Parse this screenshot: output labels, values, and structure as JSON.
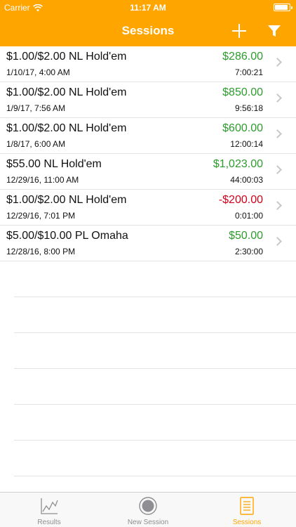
{
  "status_bar": {
    "carrier": "Carrier",
    "time": "11:17 AM",
    "battery_level": 0.9
  },
  "nav": {
    "title": "Sessions",
    "add_icon": "plus-icon",
    "filter_icon": "filter-icon"
  },
  "colors": {
    "accent": "#FFA500",
    "profit_positive": "#2E9B2E",
    "profit_negative": "#D0021B"
  },
  "sessions": [
    {
      "game": "$1.00/$2.00 NL Hold'em",
      "profit": "$286.00",
      "date": "1/10/17, 4:00 AM",
      "duration": "7:00:21",
      "positive": true
    },
    {
      "game": "$1.00/$2.00 NL Hold'em",
      "profit": "$850.00",
      "date": "1/9/17, 7:56 AM",
      "duration": "9:56:18",
      "positive": true
    },
    {
      "game": "$1.00/$2.00 NL Hold'em",
      "profit": "$600.00",
      "date": "1/8/17, 6:00 AM",
      "duration": "12:00:14",
      "positive": true
    },
    {
      "game": "$55.00 NL Hold'em",
      "profit": "$1,023.00",
      "date": "12/29/16, 11:00 AM",
      "duration": "44:00:03",
      "positive": true
    },
    {
      "game": "$1.00/$2.00 NL Hold'em",
      "profit": "-$200.00",
      "date": "12/29/16, 7:01 PM",
      "duration": "0:01:00",
      "positive": false
    },
    {
      "game": "$5.00/$10.00 PL Omaha",
      "profit": "$50.00",
      "date": "12/28/16, 8:00 PM",
      "duration": "2:30:00",
      "positive": true
    }
  ],
  "tabs": [
    {
      "label": "Results",
      "icon": "line-chart-icon",
      "active": false
    },
    {
      "label": "New Session",
      "icon": "record-icon",
      "active": false
    },
    {
      "label": "Sessions",
      "icon": "list-document-icon",
      "active": true
    }
  ]
}
